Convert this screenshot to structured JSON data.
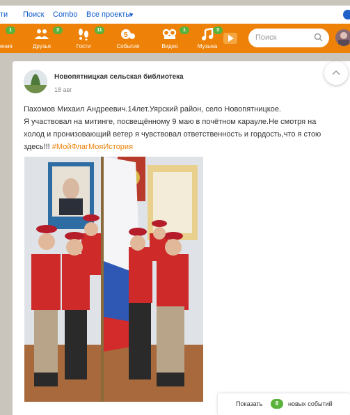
{
  "topbar": {
    "items": [
      "ти",
      "Поиск",
      "Combo",
      "Все проекты"
    ],
    "dropdown_arrow": "▼"
  },
  "toolbar": {
    "items": [
      {
        "label": "ения",
        "badge": "1",
        "icon": "messages-icon"
      },
      {
        "label": "Друзья",
        "badge": "3",
        "icon": "friends-icon"
      },
      {
        "label": "Гости",
        "badge": "11",
        "icon": "guests-icon"
      },
      {
        "label": "События",
        "badge": "",
        "icon": "events-icon"
      },
      {
        "label": "Видео",
        "badge": "1",
        "icon": "video-icon"
      },
      {
        "label": "Музыка",
        "badge": "3",
        "icon": "music-icon"
      }
    ],
    "search_placeholder": "Поиск"
  },
  "post": {
    "author": "Новопятницкая сельская библиотека",
    "date": "18 авг",
    "text_lines": [
      "Пахомов Михаил Андреевич.14лет.Уярский район, село Новопятницкое.",
      "Я участвовал на митинге, посвещённому 9 маю в почётном карауле.Не смотря на",
      "холод и пронизовающий ветер я чувствовал ответственность и гордость,что я стою"
    ],
    "last_line_prefix": "здесь!!! ",
    "hashtag": "#МойФлагМояИстория"
  },
  "events_popup": {
    "prefix": "Показать",
    "count": "8",
    "suffix": "новых событий"
  },
  "colors": {
    "accent": "#ee8208",
    "badge": "#5ab23b",
    "link": "#0a58c9"
  }
}
